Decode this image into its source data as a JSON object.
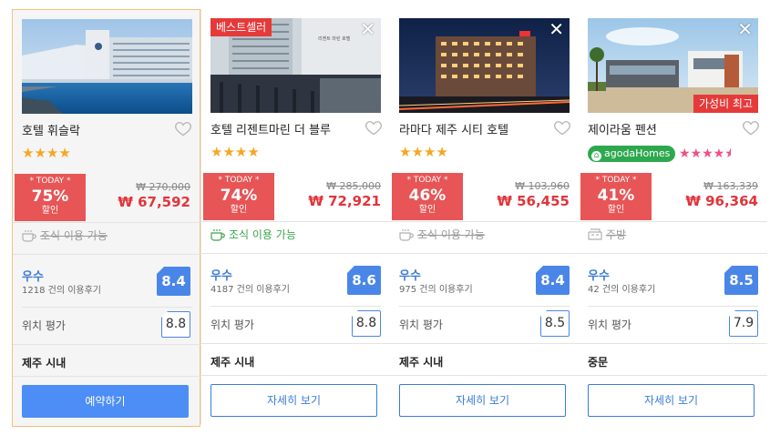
{
  "hotels": [
    {
      "name": "호텔 휘슬락",
      "stars_text": "★★★★",
      "deal_today": "* TODAY *",
      "discount_pct": "75%",
      "discount_label": "할인",
      "original_price": "₩ 270,000",
      "sale_price": "₩ 67,592",
      "amenity": "조식 이용 가능",
      "amenity_available": false,
      "review_grade": "우수",
      "review_count": "1218 건의 이용후기",
      "review_score": "8.4",
      "location_label": "위치 평가",
      "location_score": "8.8",
      "area": "제주 시내",
      "button_label": "예약하기",
      "selected": true
    },
    {
      "name": "호텔 리젠트마린 더 블루",
      "ribbon": "베스트셀러",
      "stars_text": "★★★★",
      "deal_today": "* TODAY *",
      "discount_pct": "74%",
      "discount_label": "할인",
      "original_price": "₩ 285,000",
      "sale_price": "₩ 72,921",
      "amenity": "조식 이용 가능",
      "amenity_available": true,
      "review_grade": "우수",
      "review_count": "4187 건의 이용후기",
      "review_score": "8.6",
      "location_label": "위치 평가",
      "location_score": "8.8",
      "area": "제주 시내",
      "button_label": "자세히 보기",
      "close_glyph": "✕"
    },
    {
      "name": "라마다 제주 시티 호텔",
      "stars_text": "★★★★",
      "deal_today": "* TODAY *",
      "discount_pct": "46%",
      "discount_label": "할인",
      "original_price": "₩ 103,960",
      "sale_price": "₩ 56,455",
      "amenity": "조식 이용 가능",
      "amenity_available": false,
      "review_grade": "우수",
      "review_count": "975 건의 이용후기",
      "review_score": "8.4",
      "location_label": "위치 평가",
      "location_score": "8.5",
      "area": "제주 시내",
      "button_label": "자세히 보기",
      "close_glyph": "✕"
    },
    {
      "name": "제이라움 펜션",
      "badge_br": "가성비 최고",
      "agoda_label": "agodaHomes",
      "stars_text": "★★★★",
      "stars_half": "★",
      "star_rating": 4.5,
      "deal_today": "* TODAY *",
      "discount_pct": "41%",
      "discount_label": "할인",
      "original_price": "₩ 163,339",
      "sale_price": "₩ 96,364",
      "amenity": "주방",
      "amenity_available": false,
      "review_grade": "우수",
      "review_count": "42 건의 이용후기",
      "review_score": "8.5",
      "location_label": "위치 평가",
      "location_score": "7.9",
      "area": "중문",
      "button_label": "자세히 보기",
      "close_glyph": "✕"
    }
  ],
  "colors": {
    "deal_red": "#e75556",
    "price_red": "#e0353b",
    "accent_blue": "#4a86e8",
    "star_orange": "#f5a623",
    "star_pink": "#ee4f86",
    "agoda_green": "#2ea84f",
    "amenity_green": "#3aa54a"
  }
}
